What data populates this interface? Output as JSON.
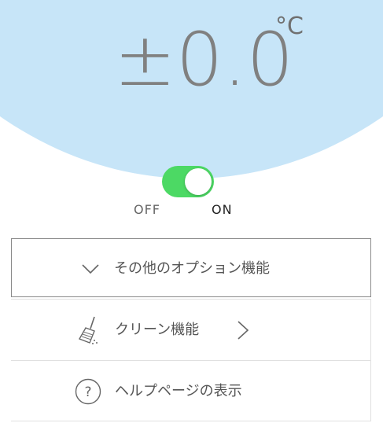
{
  "temperature": {
    "value": "±0.0",
    "unit": "°C"
  },
  "power": {
    "state": "on",
    "off_label": "OFF",
    "on_label": "ON"
  },
  "menu": {
    "options_label": "その他のオプション機能",
    "clean_label": "クリーン機能",
    "help_label": "ヘルプページの表示"
  },
  "icons": {
    "options_icon": "chevron-down-icon",
    "clean_icon": "broom-icon",
    "clean_arrow": "chevron-right-icon",
    "help_icon": "question-circle-icon"
  },
  "colors": {
    "header_bg": "#c7e5f8",
    "toggle_on": "#4cd964",
    "temperature_text": "#808080"
  }
}
